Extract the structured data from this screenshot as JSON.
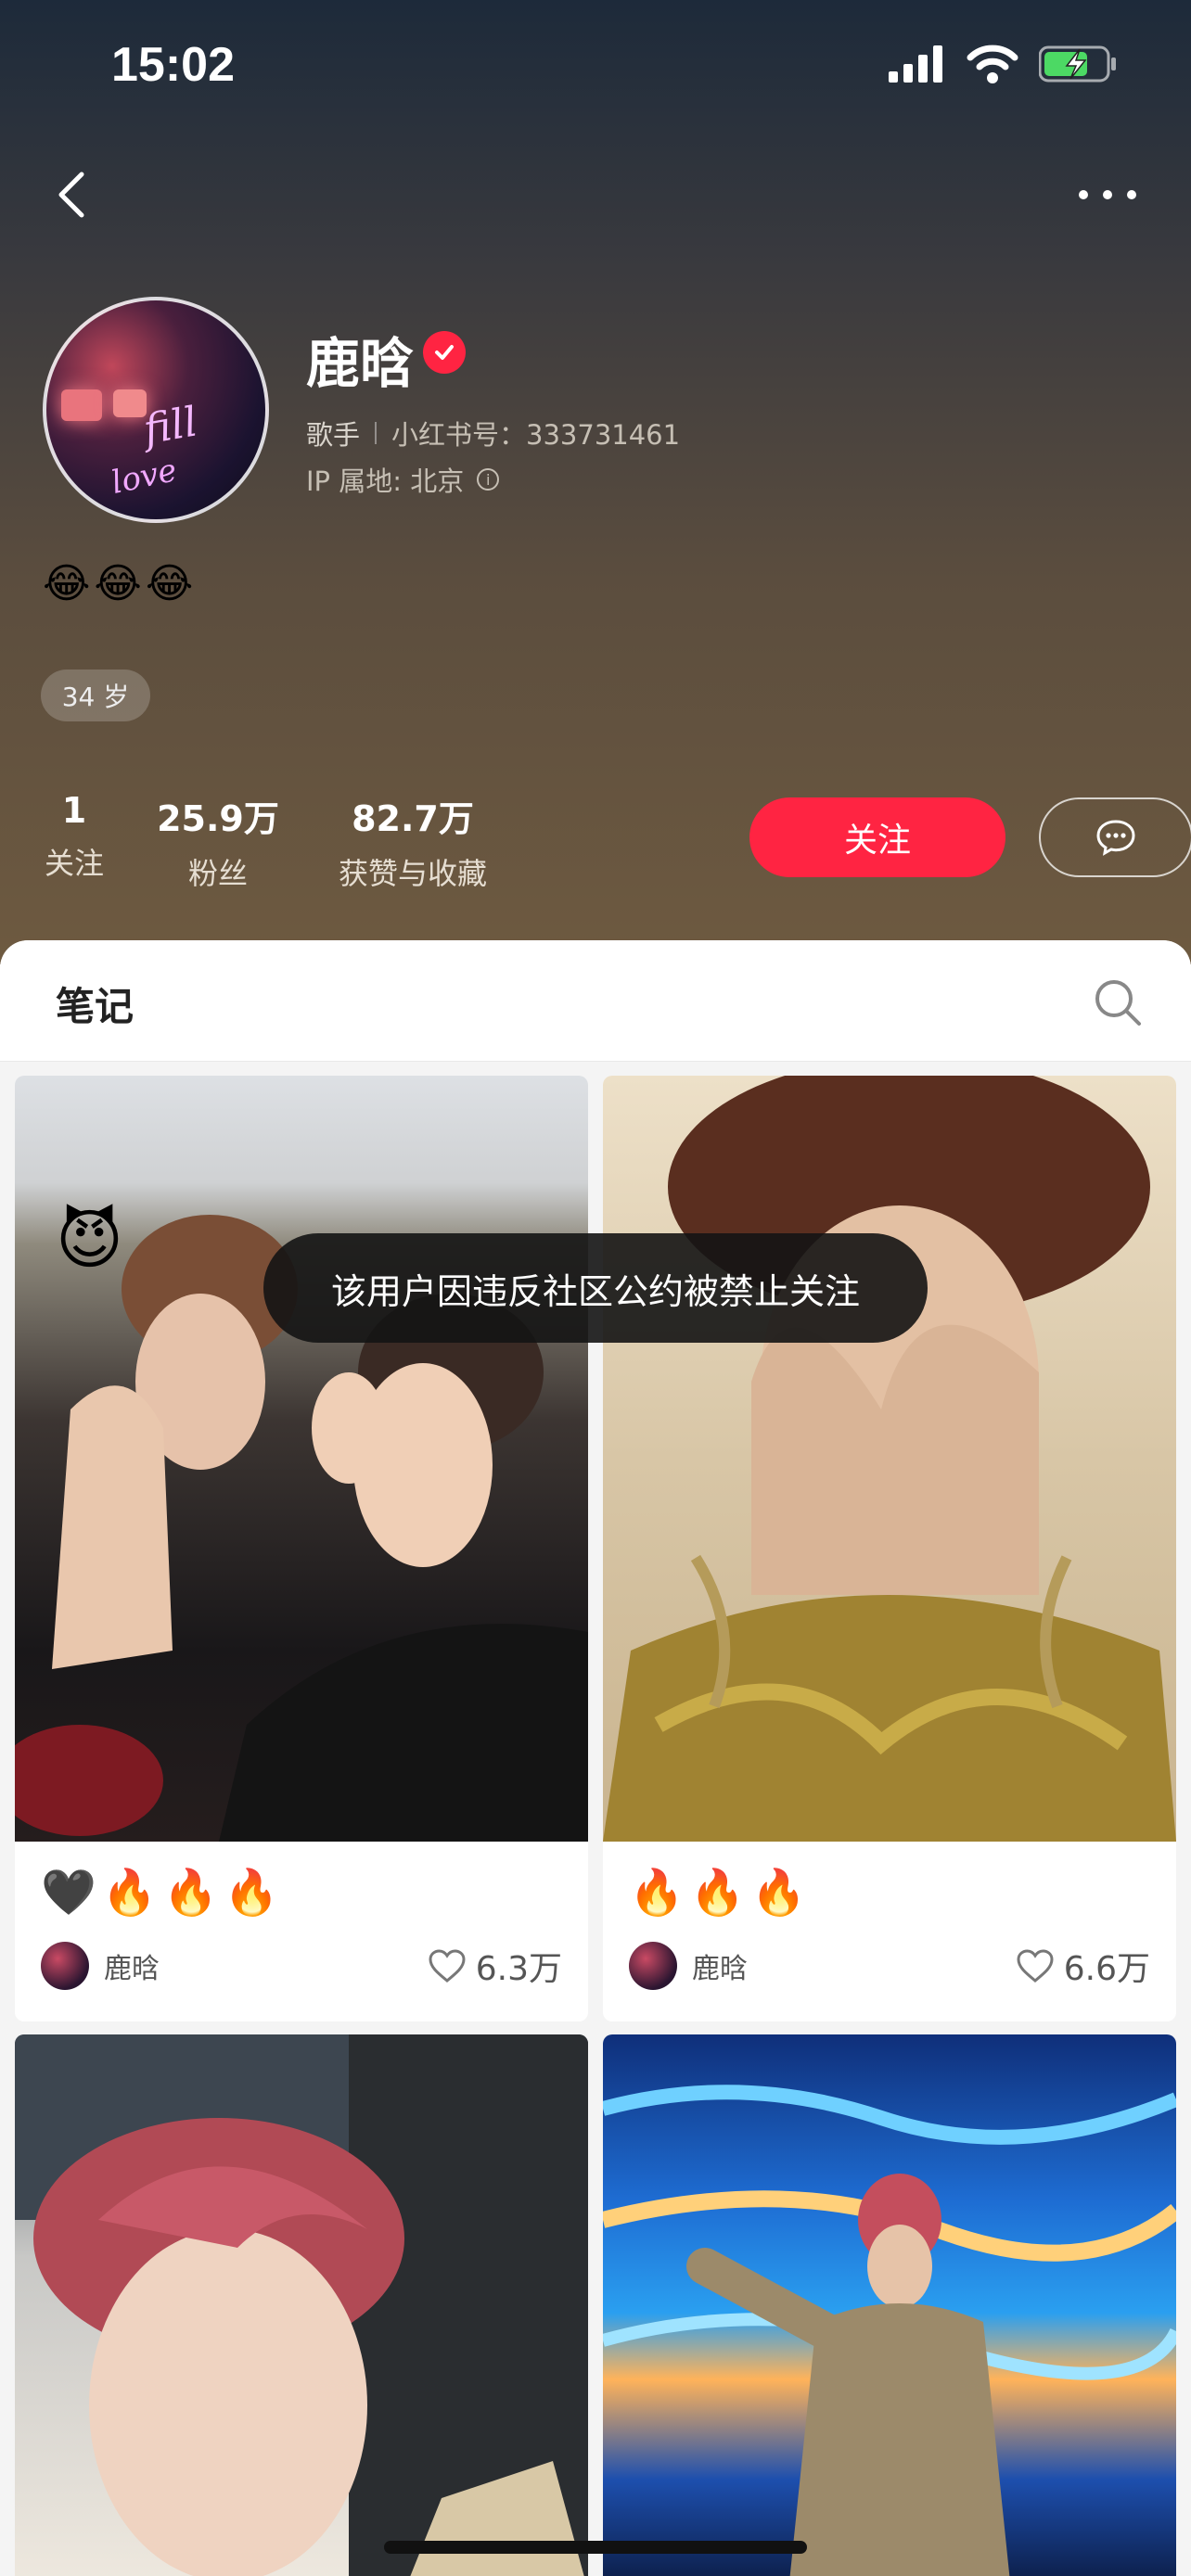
{
  "status_bar": {
    "time": "15:02"
  },
  "profile": {
    "name": "鹿晗",
    "occupation": "歌手",
    "xhs_id": "小红书号：333731461",
    "ip_location": "IP 属地: 北京",
    "bio": "😂😂😂",
    "age_tag": "34 岁"
  },
  "stats": [
    {
      "value": "1",
      "label": "关注"
    },
    {
      "value": "25.9万",
      "label": "粉丝"
    },
    {
      "value": "82.7万",
      "label": "获赞与收藏"
    }
  ],
  "actions": {
    "follow_label": "关注"
  },
  "notes_tab": {
    "title": "笔记"
  },
  "toast": "该用户因违反社区公约被禁止关注",
  "notes": [
    {
      "title": "🖤🔥🔥🔥",
      "author": "鹿晗",
      "likes": "6.3万"
    },
    {
      "title": "🔥🔥🔥",
      "author": "鹿晗",
      "likes": "6.6万"
    }
  ],
  "colors": {
    "accent": "#ff2442"
  }
}
